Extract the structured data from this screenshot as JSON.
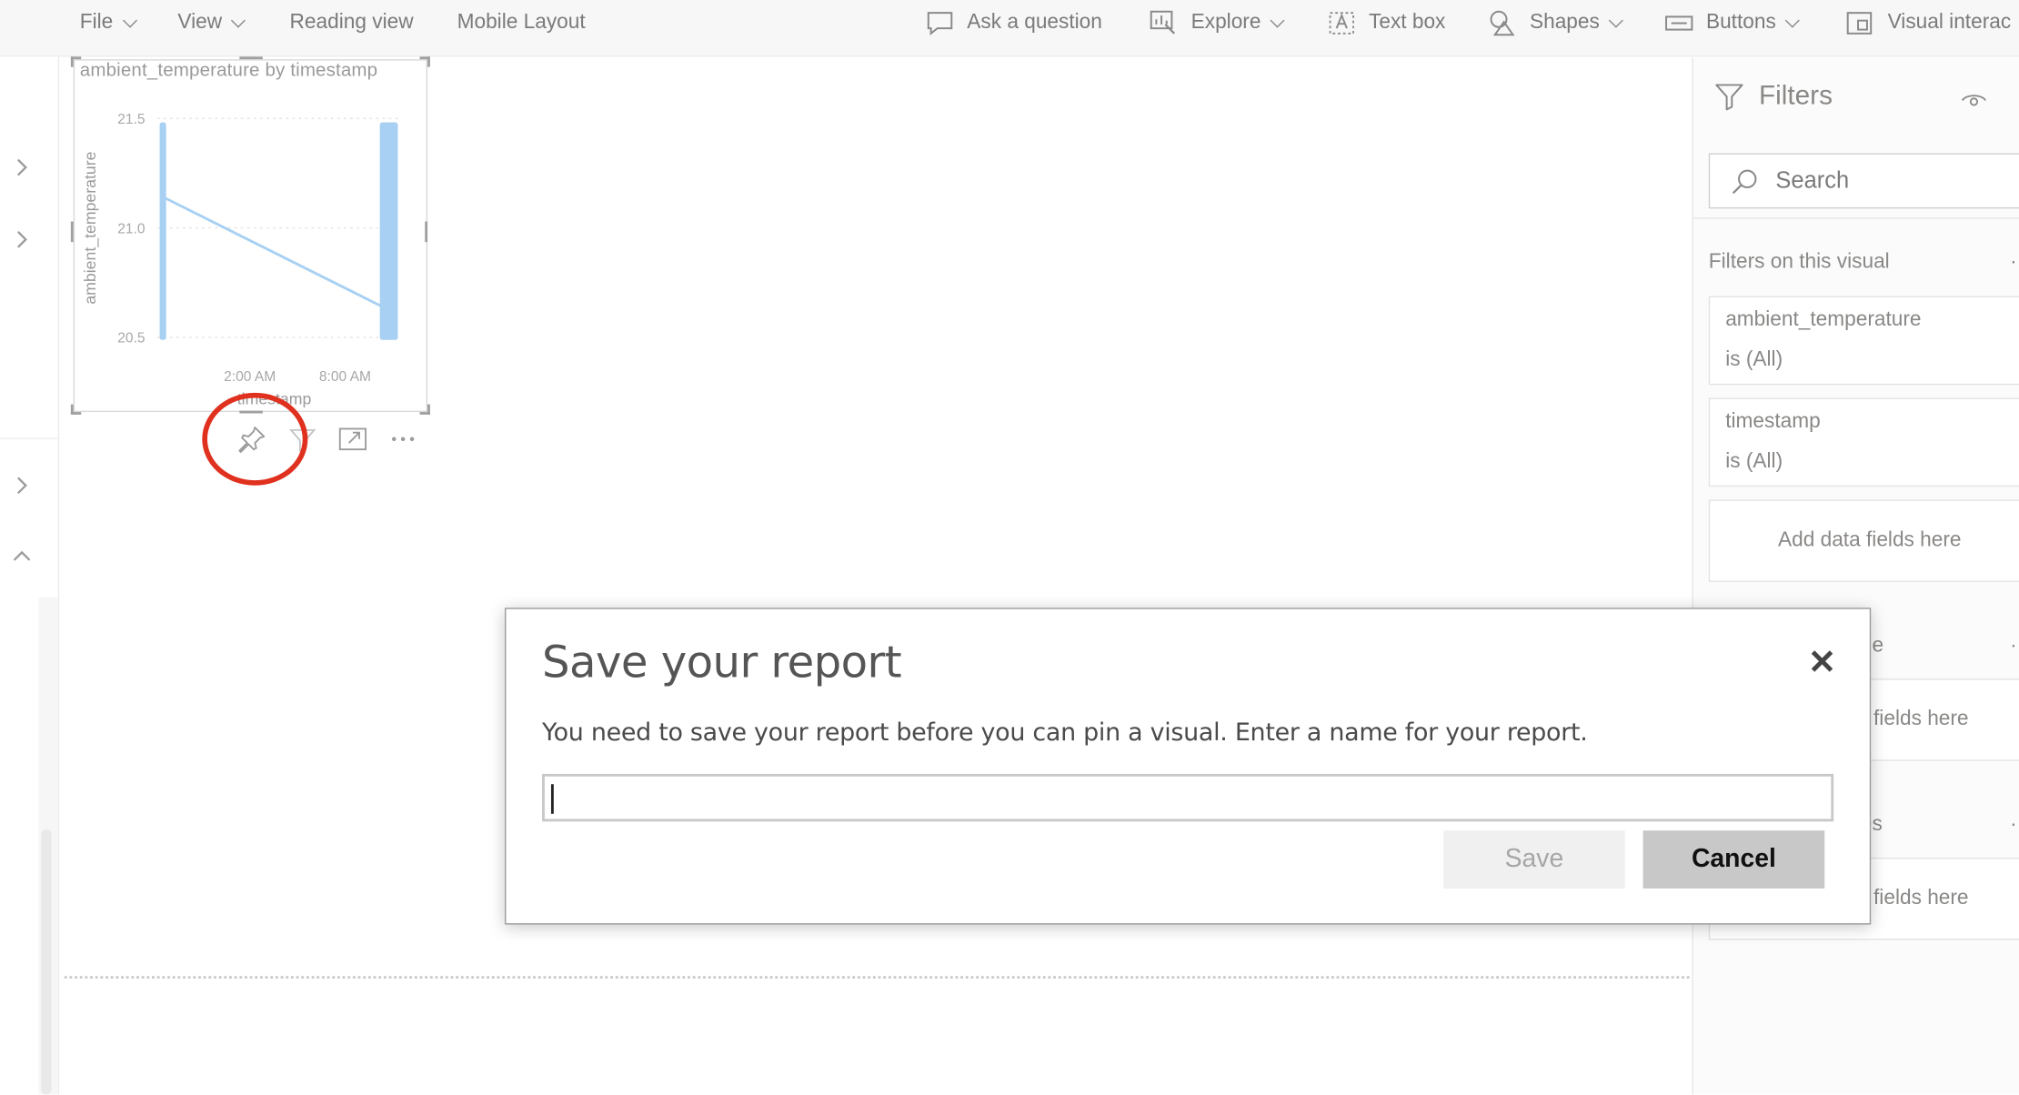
{
  "ribbon": {
    "file": "File",
    "view": "View",
    "reading_view": "Reading view",
    "mobile_layout": "Mobile Layout",
    "ask_question": "Ask a question",
    "explore": "Explore",
    "text_box": "Text box",
    "shapes": "Shapes",
    "buttons": "Buttons",
    "visual_interactions": "Visual interac"
  },
  "visual": {
    "title": "ambient_temperature by timestamp",
    "footer_icons": [
      "pin-icon",
      "filter-icon",
      "focus-mode-icon",
      "more-options-icon"
    ]
  },
  "chart_data": {
    "type": "line",
    "title": "ambient_temperature by timestamp",
    "xlabel": "timestamp",
    "ylabel": "ambient_temperature",
    "x_tick_labels": [
      "2:00 AM",
      "8:00 AM"
    ],
    "y_tick_labels": [
      "21.5",
      "21.0",
      "20.5"
    ],
    "ylim": [
      20.5,
      21.5
    ],
    "grid": true,
    "series": [
      {
        "color": "#a7d0f2",
        "description_points": [
          {
            "x": "start",
            "y": 21.14
          },
          {
            "x": "end",
            "y": 20.64
          }
        ],
        "dense_bands": [
          {
            "at": "start",
            "y_range": [
              20.5,
              21.5
            ]
          },
          {
            "at": "end",
            "y_range": [
              20.5,
              21.5
            ]
          }
        ]
      }
    ]
  },
  "filters": {
    "title": "Filters",
    "search_placeholder": "Search",
    "section_label": "Filters on this visual",
    "cards": [
      {
        "field": "ambient_temperature",
        "condition": "is (All)"
      },
      {
        "field": "timestamp",
        "condition": "is (All)"
      }
    ],
    "add_fields": "Add data fields here",
    "partial_page_label": "ge",
    "partial_add_1": "fields here",
    "partial_all_label": "es",
    "partial_add_2": "fields here"
  },
  "dialog": {
    "title": "Save your report",
    "message": "You need to save your report before you can pin a visual. Enter a name for your report.",
    "input_value": "",
    "save_label": "Save",
    "cancel_label": "Cancel",
    "close_glyph": "✕"
  },
  "colors": {
    "highlight_ring": "#e0301e",
    "series": "#a7d0f2"
  }
}
